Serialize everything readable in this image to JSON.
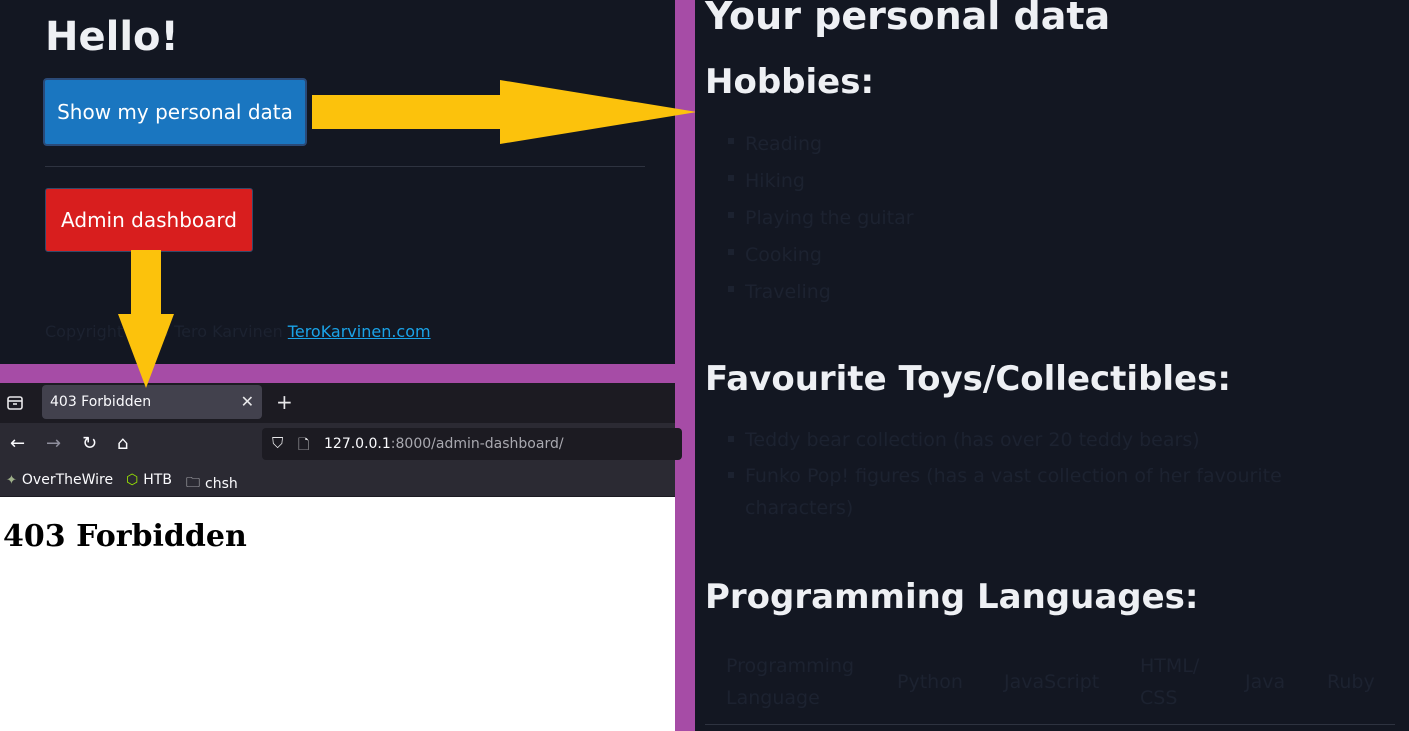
{
  "app": {
    "hello": "Hello!",
    "show_data_button": "Show my personal data",
    "admin_button": "Admin dashboard",
    "copyright_text": "Copyright 2023 Tero Karvinen",
    "copyright_link": "TeroKarvinen.com"
  },
  "browser": {
    "tab_title": "403 Forbidden",
    "url_host": "127.0.0.1",
    "url_rest": ":8000/admin-dashboard/",
    "bookmarks": [
      "OverTheWire",
      "HTB",
      "chsh"
    ],
    "page_heading": "403 Forbidden"
  },
  "personal": {
    "title": "Your personal data",
    "hobbies_heading": "Hobbies:",
    "hobbies": [
      "Reading",
      "Hiking",
      "Playing the guitar",
      "Cooking",
      "Traveling"
    ],
    "toys_heading": "Favourite Toys/Collectibles:",
    "toys": [
      "Teddy bear collection (has over 20 teddy bears)",
      "Funko Pop! figures (has a vast collection of her favourite characters)"
    ],
    "languages_heading": "Programming Languages:",
    "table_header": [
      "Programming Language",
      "Python",
      "JavaScript",
      "HTML/ CSS",
      "Java",
      "Ruby"
    ]
  },
  "colors": {
    "background_dark": "#131722",
    "border_purple": "#a64ca6",
    "blue_button": "#1a76c0",
    "red_button": "#d81e1e",
    "arrow": "#fcc20c"
  }
}
